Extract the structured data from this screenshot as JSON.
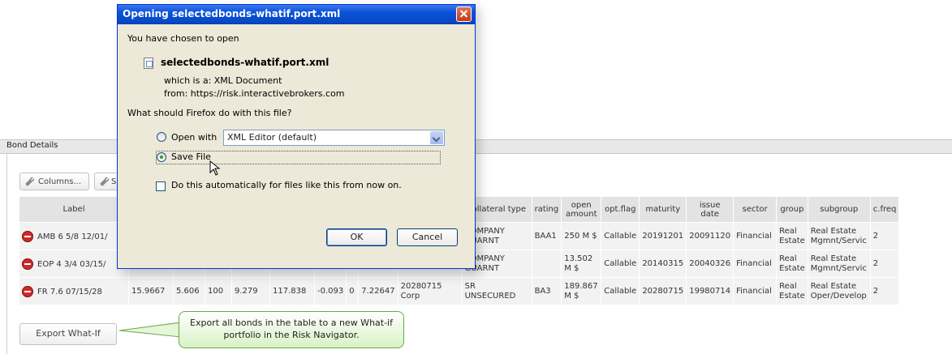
{
  "panel": {
    "title": "Bond Details"
  },
  "toolbar": {
    "columns_label": "Columns...",
    "second_label": "S"
  },
  "table": {
    "headers": [
      "Label",
      "",
      "",
      "",
      "",
      "",
      "",
      "",
      "",
      "",
      "collateral type",
      "rating",
      "open amount",
      "opt.flag",
      "maturity",
      "issue date",
      "sector",
      "group",
      "subgroup",
      "c.freq"
    ],
    "rows": [
      {
        "label": "AMB 6 5/8 12/01/",
        "c1": "",
        "c2": "",
        "c3": "",
        "c4": "",
        "c5": "",
        "c6": "",
        "c7": "",
        "c8": "",
        "c9": "",
        "collateral": "COMPANY GUARNT",
        "rating": "BAA1",
        "open": "250 M $",
        "opt": "Callable",
        "maturity": "20191201",
        "issue": "20091120",
        "sector": "Financial",
        "group": "Real Estate",
        "subgroup": "Real Estate Mgmnt/Servic",
        "cfreq": "2"
      },
      {
        "label": "EOP 4 3/4 03/15/",
        "c1": "",
        "c2": "",
        "c3": "",
        "c4": "",
        "c5": "",
        "c6": "",
        "c7": "",
        "c8": "",
        "c9": "",
        "collateral": "COMPANY GUARNT",
        "rating": "",
        "open": "13.502 M $",
        "opt": "Callable",
        "maturity": "20140315",
        "issue": "20040326",
        "sector": "Financial",
        "group": "Real Estate",
        "subgroup": "Real Estate Mgmnt/Servic",
        "cfreq": "2"
      },
      {
        "label": "FR 7.6 07/15/28",
        "c1": "15.9667",
        "c2": "5.606",
        "c3": "100",
        "c4": "9.279",
        "c5": "117.838",
        "c6": "-0.093",
        "c7": "0",
        "c8": "7.22647",
        "c9": "20280715",
        "c10": "Corp",
        "collateral": "SR UNSECURED",
        "rating": "BA3",
        "open": "189.867 M $",
        "opt": "Callable",
        "maturity": "20280715",
        "issue": "19980714",
        "sector": "Financial",
        "group": "Real Estate",
        "subgroup": "Real Estate Oper/Develop",
        "cfreq": "2"
      }
    ]
  },
  "export_button": "Export What-If",
  "callout": "Export all bonds in the table to a new What-if portfolio in the Risk Navigator.",
  "dialog": {
    "title": "Opening selectedbonds-whatif.port.xml",
    "chosen": "You have chosen to open",
    "filename": "selectedbonds-whatif.port.xml",
    "which_is": "which is a:  XML Document",
    "from": "from:  https://risk.interactivebrokers.com",
    "question": "What should Firefox do with this file?",
    "open_with": "Open with",
    "app": "XML Editor (default)",
    "save_file": "Save File",
    "auto": "Do this automatically for files like this from now on.",
    "ok": "OK",
    "cancel": "Cancel"
  },
  "colors": {
    "titlebar": "#0a52d8",
    "callout_border": "#6aa84f",
    "remove_icon": "#cc2a2a"
  }
}
